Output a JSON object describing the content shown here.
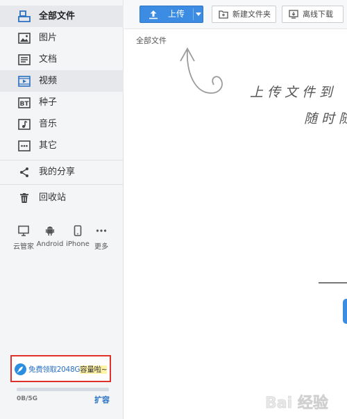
{
  "sidebar": {
    "items": [
      {
        "label": "全部文件",
        "icon": "all-files-icon"
      },
      {
        "label": "图片",
        "icon": "image-icon"
      },
      {
        "label": "文档",
        "icon": "document-icon"
      },
      {
        "label": "视频",
        "icon": "video-icon"
      },
      {
        "label": "种子",
        "icon": "bt-icon"
      },
      {
        "label": "音乐",
        "icon": "music-icon"
      },
      {
        "label": "其它",
        "icon": "more-icon"
      }
    ],
    "share_label": "我的分享",
    "trash_label": "回收站",
    "clients": [
      {
        "label": "云管家",
        "icon": "monitor-icon"
      },
      {
        "label": "Android",
        "icon": "android-icon"
      },
      {
        "label": "iPhone",
        "icon": "phone-icon"
      },
      {
        "label": "更多",
        "icon": "ellipsis-icon"
      }
    ],
    "promo": {
      "text_main": "免费领取2048G",
      "text_highlight": "容量啦~"
    },
    "quota": {
      "used_text": "0B/5G",
      "fraction": 0.0,
      "expand_label": "扩容"
    }
  },
  "toolbar": {
    "upload_label": "上传",
    "new_folder_label": "新建文件夹",
    "offline_label": "离线下载"
  },
  "breadcrumb": "全部文件",
  "hint": {
    "line1": "上传文件到",
    "line2": "随时随"
  },
  "watermark": "Bai 经验",
  "colors": {
    "accent": "#3b8ce2",
    "promo_border": "#e0302a",
    "link": "#2670c6"
  }
}
